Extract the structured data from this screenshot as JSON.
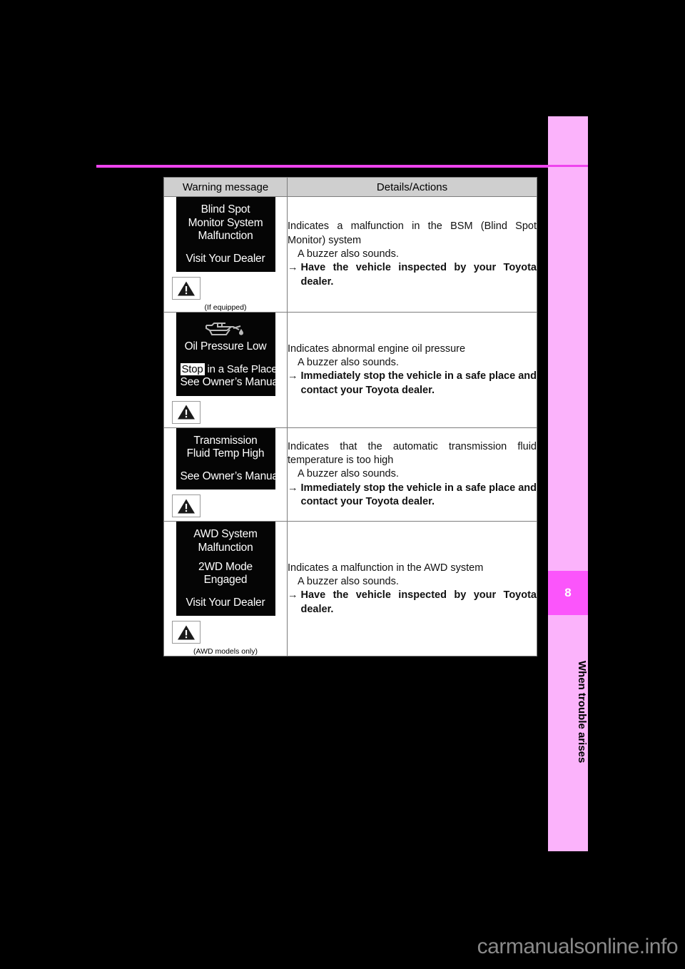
{
  "page": {
    "background_color": "#000000",
    "rule_color": "#ee44ee",
    "sidebar_color": "#fbb3fb",
    "chapter_box_color": "#fb55fb",
    "chapter_number": "8",
    "chapter_title": "When trouble arises",
    "watermark": "carmanualsonline.info"
  },
  "table": {
    "headers": {
      "warning_message": "Warning message",
      "details_actions": "Details/Actions"
    },
    "rows": [
      {
        "display_lines": [
          "Blind Spot",
          "Monitor System",
          "Malfunction"
        ],
        "display_lines_2": [
          "Visit Your Dealer"
        ],
        "icon": "warning-triangle-icon",
        "note": "(If equipped)",
        "details": {
          "intro": "Indicates a malfunction in the BSM (Blind Spot Monitor) system",
          "sub": "A buzzer also sounds.",
          "arrow": "→",
          "action": "Have the vehicle inspected by your Toyota dealer."
        }
      },
      {
        "display_icon": "oil-can-icon",
        "display_lines": [
          "Oil Pressure Low"
        ],
        "stop_chip": "Stop",
        "stop_rest": " in a Safe Place",
        "display_lines_2": [
          "See Owner’s Manual"
        ],
        "icon": "warning-triangle-icon",
        "note": "",
        "details": {
          "intro": "Indicates abnormal engine oil pressure",
          "sub": "A buzzer also sounds.",
          "arrow": "→",
          "action": "Immediately stop the vehicle in a safe place and contact your Toyota dealer."
        }
      },
      {
        "display_lines": [
          "Transmission",
          "Fluid Temp High"
        ],
        "display_lines_2": [
          "See Owner’s Manual"
        ],
        "icon": "warning-triangle-icon",
        "note": "",
        "details": {
          "intro": "Indicates that the automatic transmission fluid temperature is too high",
          "sub": "A buzzer also sounds.",
          "arrow": "→",
          "action": "Immediately stop the vehicle in a safe place and contact your Toyota dealer."
        }
      },
      {
        "display_lines": [
          "AWD System",
          "Malfunction",
          "2WD Mode",
          "Engaged"
        ],
        "display_lines_2": [
          "Visit Your Dealer"
        ],
        "icon": "warning-triangle-icon",
        "note": "(AWD models only)",
        "details": {
          "intro": "Indicates a malfunction in the AWD system",
          "sub": "A buzzer also sounds.",
          "arrow": "→",
          "action": "Have the vehicle inspected by your Toyota dealer."
        }
      }
    ]
  }
}
